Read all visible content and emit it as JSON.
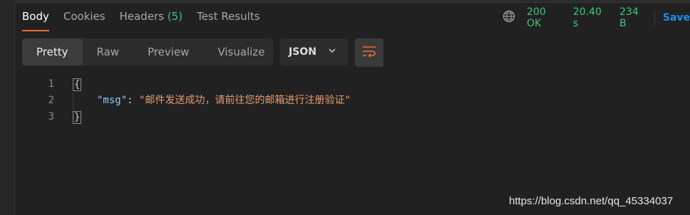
{
  "tabs": [
    {
      "label": "Body",
      "active": true
    },
    {
      "label": "Cookies"
    },
    {
      "label": "Headers",
      "count": "(5)"
    },
    {
      "label": "Test Results"
    }
  ],
  "status": {
    "code": "200 OK",
    "time": "20.40 s",
    "size": "234 B",
    "save": "Save"
  },
  "view_modes": [
    "Pretty",
    "Raw",
    "Preview",
    "Visualize"
  ],
  "active_view": "Pretty",
  "format": "JSON",
  "icons": [
    "globe-icon",
    "chevron-down-icon",
    "wrap-lines-icon"
  ],
  "response": {
    "line_numbers": [
      "1",
      "2",
      "3"
    ],
    "open_brace": "{",
    "close_brace": "}",
    "key": "\"msg\"",
    "colon": ":",
    "value": "\"邮件发送成功，请前往您的邮箱进行注册验证\""
  },
  "watermark": "https://blog.csdn.net/qq_45334037",
  "colors": {
    "accent": "#f26b3a",
    "success": "#49c279",
    "link": "#1f8ef1",
    "json_key": "#8ec8ff",
    "json_string": "#e89c6a"
  }
}
